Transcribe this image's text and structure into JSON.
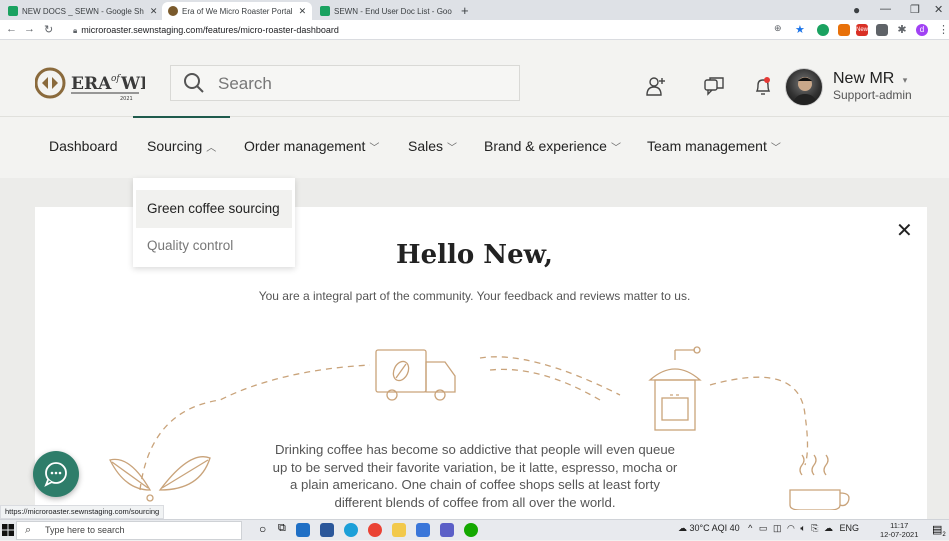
{
  "browser": {
    "tabs": [
      {
        "title": "NEW DOCS _ SEWN - Google Sh",
        "active": false,
        "icon": "google-sheets-icon",
        "color": "#1aa260"
      },
      {
        "title": "Era of We Micro Roaster Portal",
        "active": true,
        "icon": "era-of-we-favicon",
        "color": "#7a5a2c"
      },
      {
        "title": "SEWN - End User Doc List - Goo",
        "active": false,
        "icon": "google-sheets-icon",
        "color": "#1aa260"
      }
    ],
    "url": "microroaster.sewnstaging.com/features/micro-roaster-dashboard",
    "profile_initial": "d",
    "new_badge": "New"
  },
  "header": {
    "logo_text": "ERA of WE",
    "logo_year": "2021",
    "search_placeholder": "Search",
    "user_name": "New MR",
    "user_role": "Support-admin"
  },
  "nav": {
    "items": [
      {
        "label": "Dashboard",
        "chevron": ""
      },
      {
        "label": "Sourcing",
        "chevron": "^"
      },
      {
        "label": "Order management",
        "chevron": "v"
      },
      {
        "label": "Sales",
        "chevron": "v"
      },
      {
        "label": "Brand & experience",
        "chevron": "v"
      },
      {
        "label": "Team management",
        "chevron": "v"
      }
    ],
    "dropdown": [
      "Green coffee sourcing",
      "Quality control"
    ]
  },
  "welcome": {
    "title": "Hello New,",
    "subtitle": "You are a integral part of the community. Your feedback and reviews matter to us.",
    "body": "Drinking coffee has become so addictive that people will even queue up to be served their favorite variation, be it latte, espresso, mocha or a plain americano. One chain of coffee shops sells at least forty different blends of coffee from all over the world."
  },
  "status_link": "https://microroaster.sewnstaging.com/sourcing",
  "taskbar": {
    "search_placeholder": "Type here to search",
    "weather": "30°C AQI 40",
    "lang": "ENG",
    "time": "11:17",
    "date": "12-07-2021",
    "notification_count": "2"
  },
  "colors": {
    "accent": "#1f5b4d",
    "illustration": "#c9a37a",
    "chat": "#2e7d6a"
  }
}
